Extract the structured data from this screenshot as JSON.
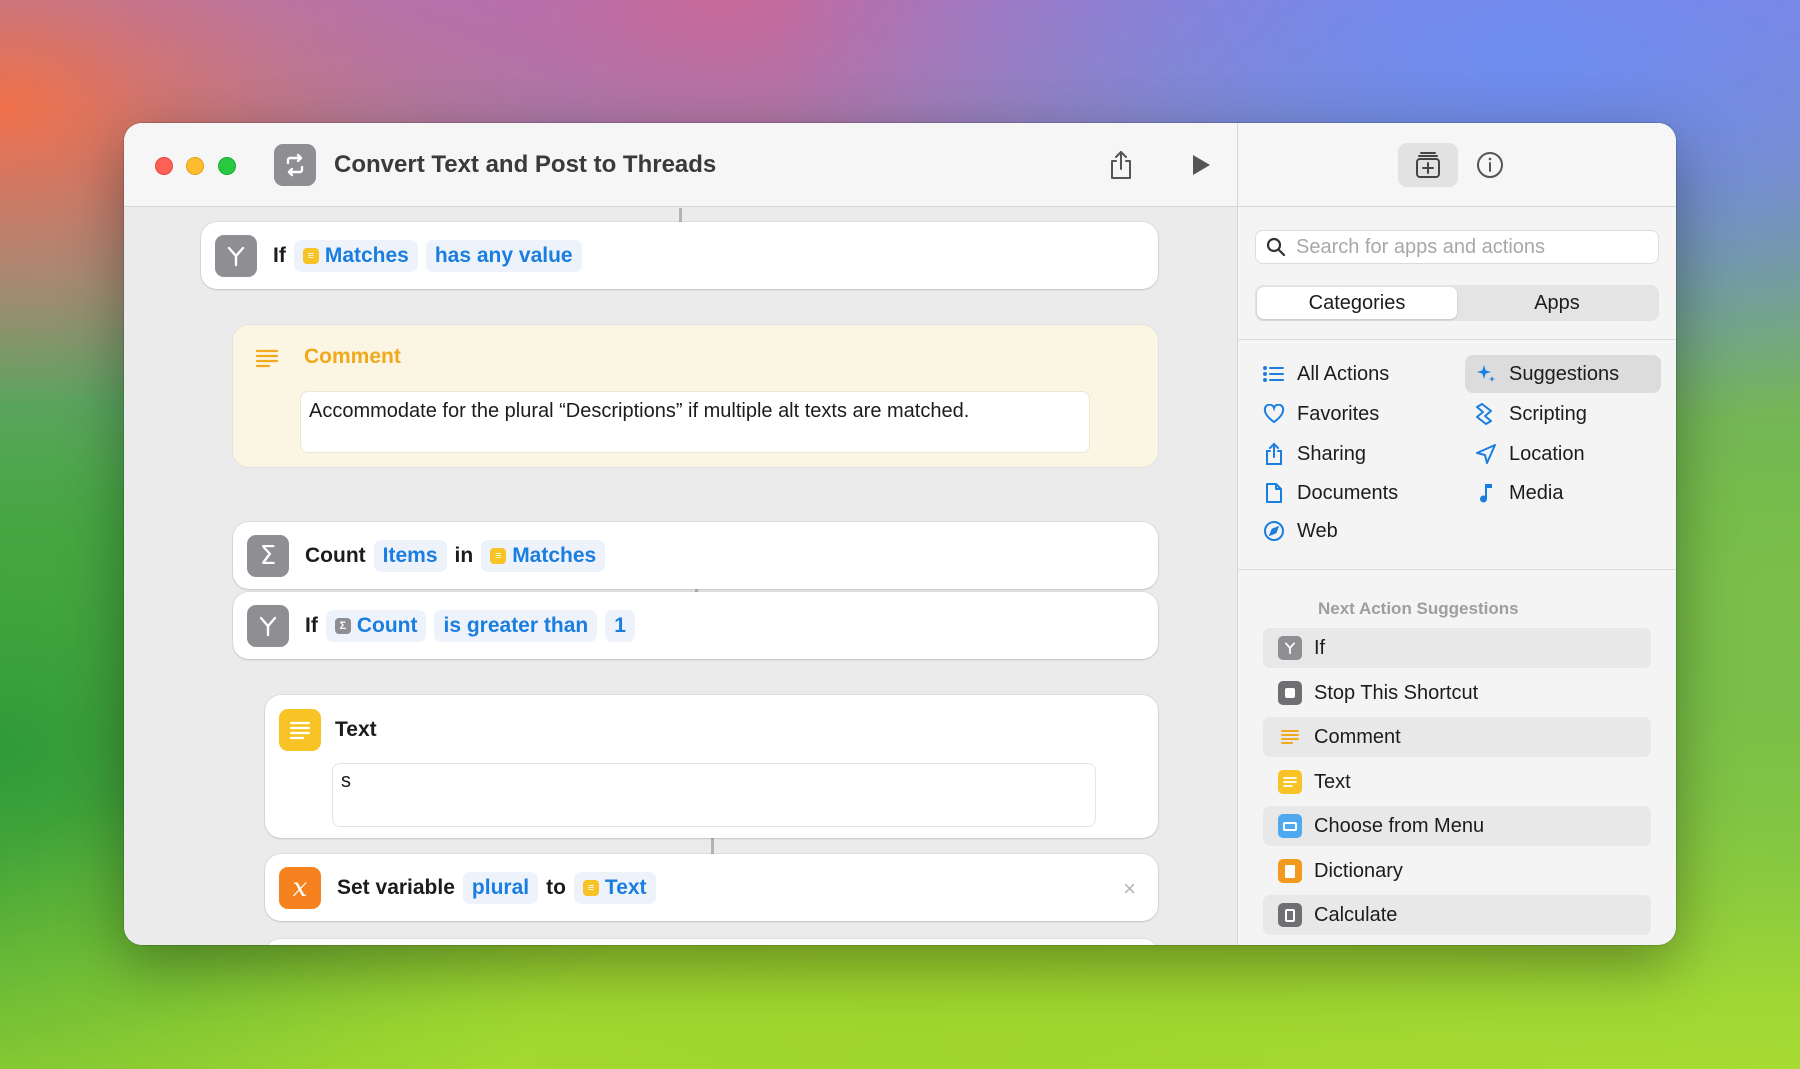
{
  "window": {
    "title": "Convert Text and Post to Threads"
  },
  "actions": [
    {
      "type": "if",
      "keyword": "If",
      "variable": "Matches",
      "condition": "has any value"
    },
    {
      "type": "comment",
      "title": "Comment",
      "text": "Accommodate for the plural “Descriptions” if multiple alt texts are matched."
    },
    {
      "type": "count",
      "keyword": "Count",
      "subject": "Items",
      "preposition": "in",
      "variable": "Matches"
    },
    {
      "type": "if",
      "keyword": "If",
      "variable": "Count",
      "condition": "is greater than",
      "value": "1"
    },
    {
      "type": "text",
      "title": "Text",
      "text": "s"
    },
    {
      "type": "set-variable",
      "keyword": "Set variable",
      "name": "plural",
      "preposition": "to",
      "variable": "Text",
      "close": "×"
    }
  ],
  "sidebar": {
    "search_placeholder": "Search for apps and actions",
    "segments": [
      "Categories",
      "Apps"
    ],
    "categories_left": [
      "All Actions",
      "Favorites",
      "Sharing",
      "Documents",
      "Web"
    ],
    "categories_right": [
      "Suggestions",
      "Scripting",
      "Location",
      "Media"
    ],
    "selected_category": "Suggestions",
    "next_title": "Next Action Suggestions",
    "suggestions": [
      "If",
      "Stop This Shortcut",
      "Comment",
      "Text",
      "Choose from Menu",
      "Dictionary",
      "Calculate"
    ]
  },
  "colors": {
    "token_blue": "#1a7ee0",
    "comment_accent": "#f2a91c",
    "text_icon": "#f7c325",
    "variable_icon": "#f5821f",
    "control_icon": "#8e8e93",
    "menu_icon": "#4fa9f0",
    "dictionary_icon": "#f29a1f"
  },
  "icons": {
    "app": "repeat-square-icon",
    "share": "share-icon",
    "run": "play-icon",
    "library": "add-library-icon",
    "info": "info-icon"
  }
}
